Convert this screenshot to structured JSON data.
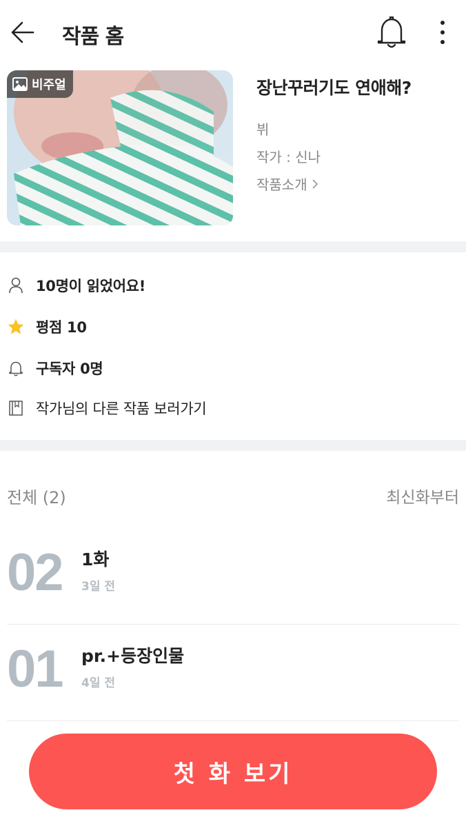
{
  "header": {
    "title": "작품 홈",
    "back_icon": "arrow-left-icon",
    "bell_icon": "bell-icon",
    "more_icon": "more-vertical-icon"
  },
  "work": {
    "badge_label": "비주얼",
    "title": "장난꾸러기도 연애해?",
    "genre": "뷔",
    "author": "작가 : 신나",
    "intro_link": "작품소개"
  },
  "stats": {
    "readers": "10명이 읽었어요!",
    "rating": "평점 10",
    "subscribers": "구독자 0명",
    "other_works": "작가님의 다른 작품 보러가기"
  },
  "episode_list": {
    "total": "전체 (2)",
    "sort_label": "최신화부터",
    "episodes": [
      {
        "number": "02",
        "title": "1화",
        "time": "3일 전"
      },
      {
        "number": "01",
        "title": "pr.+등장인물",
        "time": "4일 전"
      }
    ]
  },
  "cta": {
    "label": "첫 화 보기"
  },
  "colors": {
    "accent": "#fd5552",
    "star": "#f7c325",
    "divider_band": "#f0f2f4",
    "muted_text": "#888888"
  }
}
